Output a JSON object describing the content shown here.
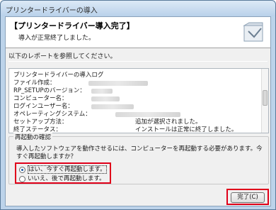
{
  "window": {
    "title": "プリンタードライバーの導入"
  },
  "header": {
    "title": "【プリンタードライバー導入完了】",
    "subtitle": "導入が正常終了しました。",
    "icon": "installer-box-icon"
  },
  "instruction": "以下のレポートを参照してください。",
  "report": {
    "heading": "プリンタードライバーの導入ログ",
    "rows": [
      {
        "label": "ファイル作成：",
        "value": ""
      },
      {
        "label": "RP_SETUPのバージョン：",
        "value": ""
      },
      {
        "label": "コンピューター名：",
        "value": ""
      },
      {
        "label": "ログインユーザー名：",
        "value": ""
      },
      {
        "label": "オペレーティングシステム：",
        "value": ""
      },
      {
        "label": "セットアップ方法：",
        "value": "追加が選択されました。"
      },
      {
        "label": "終了ステータス：",
        "value": "インストールは正常に終了しました。"
      }
    ]
  },
  "restart": {
    "group_title": "再起動の確認",
    "message": "導入したソフトウェアを動作させるには、コンピューターを再起動する必要があります。今すぐ再起動しますか？",
    "options": [
      {
        "label": "はい、今すぐ再起動します。",
        "selected": true
      },
      {
        "label": "いいえ、後で再起動します。",
        "selected": false
      }
    ]
  },
  "buttons": {
    "finish": "完了(C)"
  },
  "colors": {
    "highlight": "#e0001a",
    "titlebar": "#b9d1ea"
  }
}
